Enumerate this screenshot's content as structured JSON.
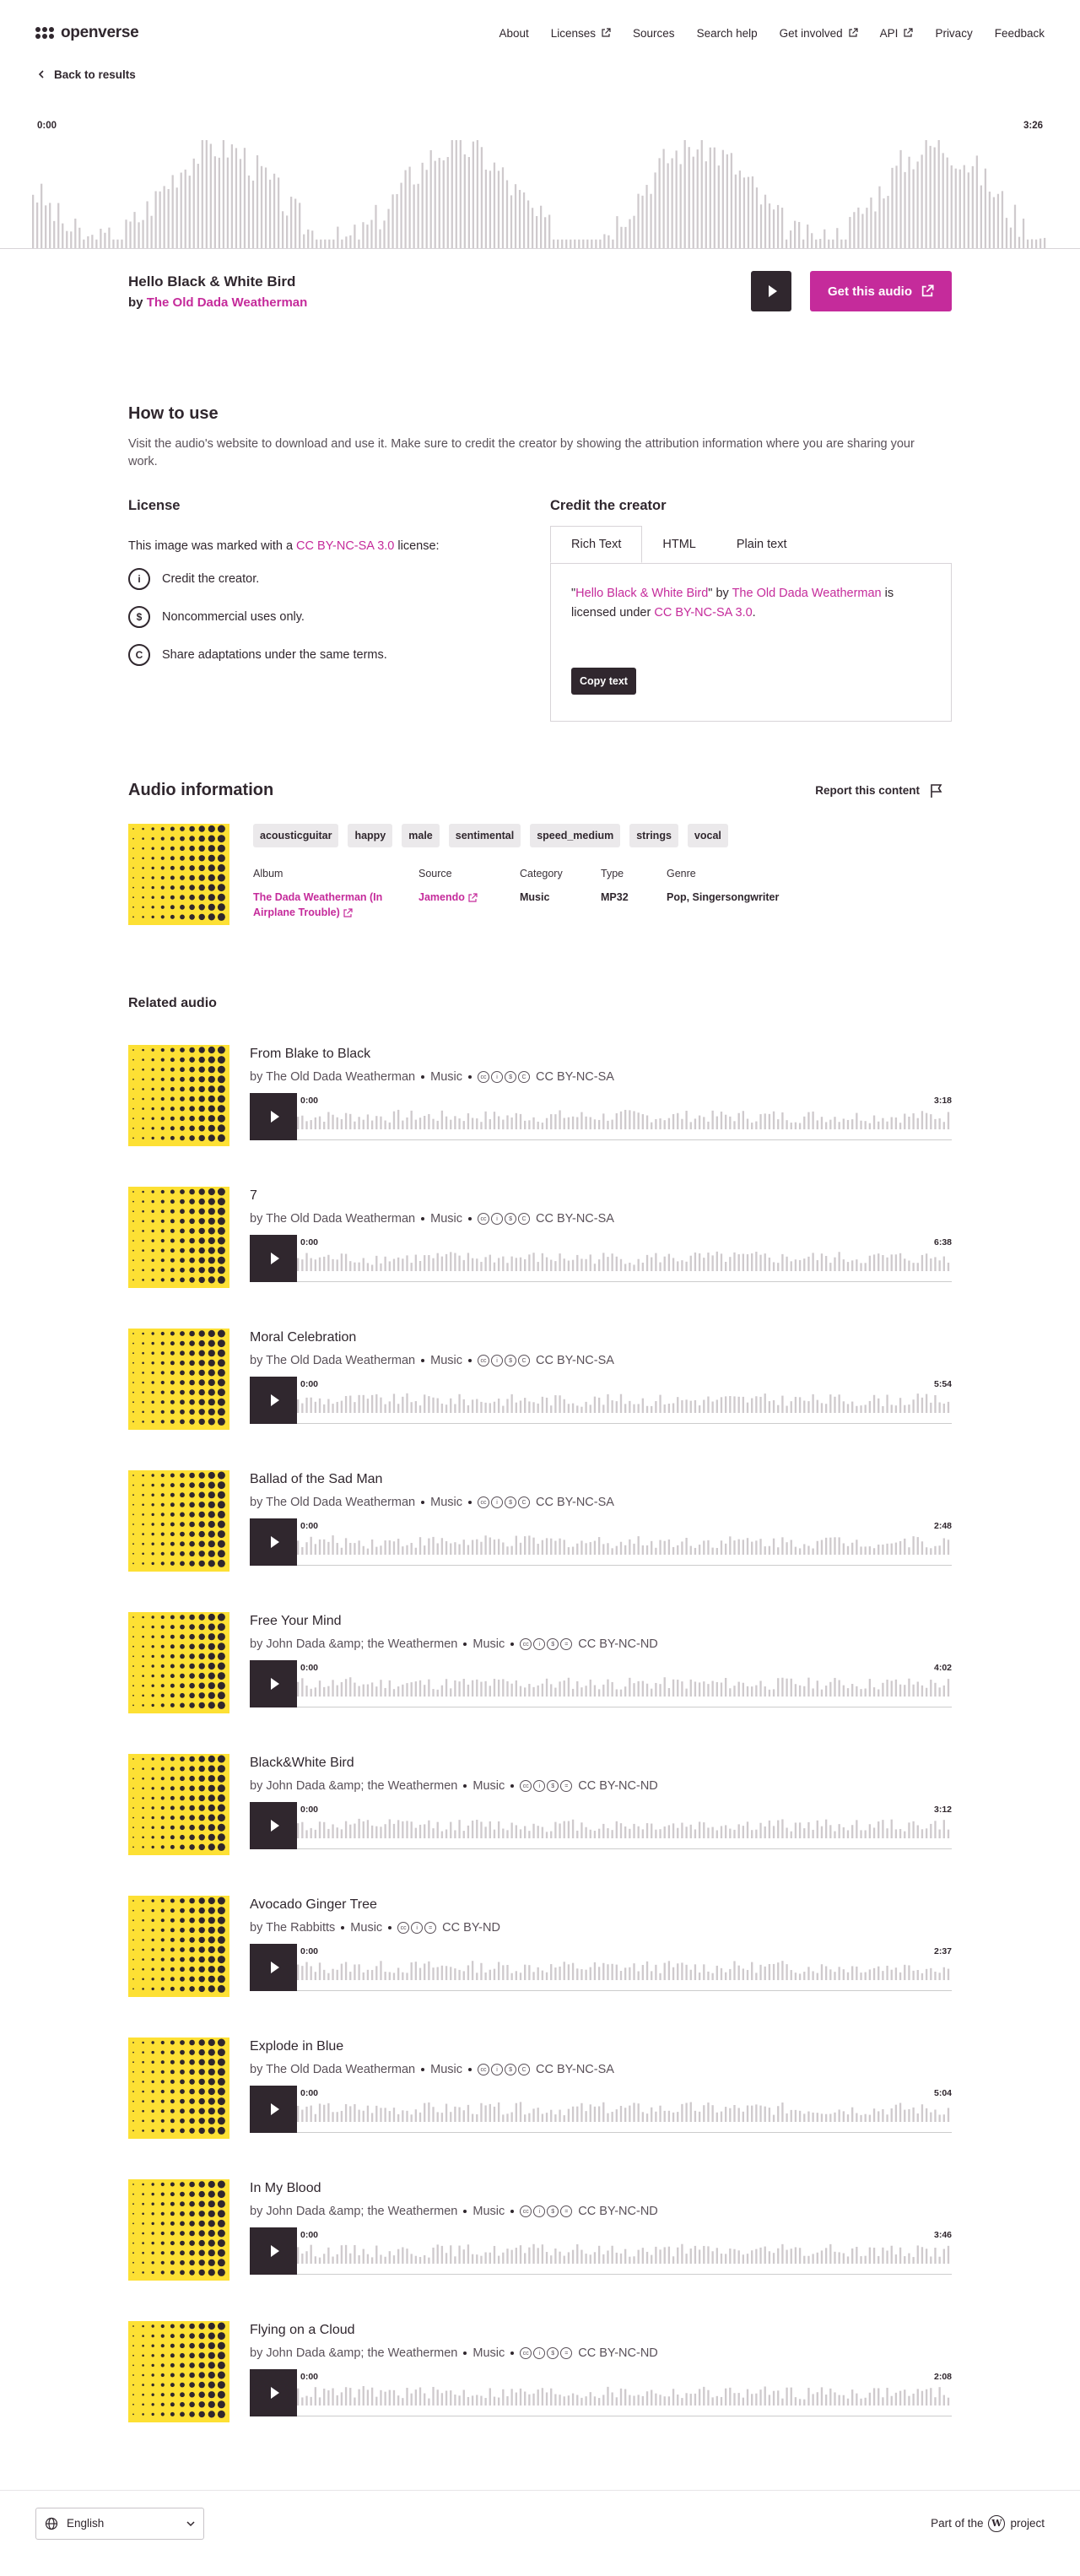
{
  "header": {
    "logo_text": "openverse",
    "nav": [
      {
        "label": "About",
        "external": false
      },
      {
        "label": "Licenses",
        "external": true
      },
      {
        "label": "Sources",
        "external": false
      },
      {
        "label": "Search help",
        "external": false
      },
      {
        "label": "Get involved",
        "external": true
      },
      {
        "label": "API",
        "external": true
      },
      {
        "label": "Privacy",
        "external": false
      },
      {
        "label": "Feedback",
        "external": false
      }
    ]
  },
  "back_label": "Back to results",
  "main_audio": {
    "start_time": "0:00",
    "end_time": "3:26",
    "title": "Hello Black & White Bird",
    "by_prefix": "by",
    "creator": "The Old Dada Weatherman",
    "get_button": "Get this audio"
  },
  "howto": {
    "title": "How to use",
    "description": "Visit the audio's website to download and use it. Make sure to credit the creator by showing the attribution information where you are sharing your work.",
    "license_title": "License",
    "license_prefix": "This image was marked with a",
    "license_name": "CC BY-NC-SA 3.0",
    "license_suffix": "license:",
    "conditions": [
      {
        "icon": "by-icon",
        "glyph": "i",
        "text": "Credit the creator."
      },
      {
        "icon": "nc-icon",
        "glyph": "$",
        "text": "Noncommercial uses only."
      },
      {
        "icon": "sa-icon",
        "glyph": "C",
        "text": "Share adaptations under the same terms."
      }
    ],
    "credit_title": "Credit the creator",
    "tabs": [
      "Rich Text",
      "HTML",
      "Plain text"
    ],
    "credit": {
      "open_quote": "\"",
      "work": "Hello Black & White Bird",
      "close_by": "\" by",
      "creator": "The Old Dada Weatherman",
      "is_licensed": "is licensed under",
      "license": "CC BY-NC-SA 3.0",
      "period": "."
    },
    "copy_button": "Copy text"
  },
  "audio_info": {
    "title": "Audio information",
    "report": "Report this content",
    "tags": [
      "acousticguitar",
      "happy",
      "male",
      "sentimental",
      "speed_medium",
      "strings",
      "vocal"
    ],
    "meta": [
      {
        "label": "Album",
        "value": "The Dada Weatherman (In Airplane Trouble)",
        "link": true,
        "external": true
      },
      {
        "label": "Source",
        "value": "Jamendo",
        "link": true,
        "external": true
      },
      {
        "label": "Category",
        "value": "Music",
        "link": false,
        "external": false
      },
      {
        "label": "Type",
        "value": "MP32",
        "link": false,
        "external": false
      },
      {
        "label": "Genre",
        "value": "Pop, Singersongwriter",
        "link": false,
        "external": false
      }
    ]
  },
  "related": {
    "title": "Related audio",
    "items": [
      {
        "title": "From Blake to Black",
        "creator": "by The Old Dada Weatherman",
        "category": "Music",
        "license": "CC BY-NC-SA",
        "icons": [
          "cc",
          "by",
          "nc",
          "sa"
        ],
        "start": "0:00",
        "duration": "3:18"
      },
      {
        "title": "7",
        "creator": "by The Old Dada Weatherman",
        "category": "Music",
        "license": "CC BY-NC-SA",
        "icons": [
          "cc",
          "by",
          "nc",
          "sa"
        ],
        "start": "0:00",
        "duration": "6:38"
      },
      {
        "title": "Moral Celebration",
        "creator": "by The Old Dada Weatherman",
        "category": "Music",
        "license": "CC BY-NC-SA",
        "icons": [
          "cc",
          "by",
          "nc",
          "sa"
        ],
        "start": "0:00",
        "duration": "5:54"
      },
      {
        "title": "Ballad of the Sad Man",
        "creator": "by The Old Dada Weatherman",
        "category": "Music",
        "license": "CC BY-NC-SA",
        "icons": [
          "cc",
          "by",
          "nc",
          "sa"
        ],
        "start": "0:00",
        "duration": "2:48"
      },
      {
        "title": "Free Your Mind",
        "creator": "by John Dada &amp; the Weathermen",
        "category": "Music",
        "license": "CC BY-NC-ND",
        "icons": [
          "cc",
          "by",
          "nc",
          "nd"
        ],
        "start": "0:00",
        "duration": "4:02"
      },
      {
        "title": "Black&White Bird",
        "creator": "by John Dada &amp; the Weathermen",
        "category": "Music",
        "license": "CC BY-NC-ND",
        "icons": [
          "cc",
          "by",
          "nc",
          "nd"
        ],
        "start": "0:00",
        "duration": "3:12"
      },
      {
        "title": "Avocado Ginger Tree",
        "creator": "by The Rabbitts",
        "category": "Music",
        "license": "CC BY-ND",
        "icons": [
          "cc",
          "by",
          "nd"
        ],
        "start": "0:00",
        "duration": "2:37"
      },
      {
        "title": "Explode in Blue",
        "creator": "by The Old Dada Weatherman",
        "category": "Music",
        "license": "CC BY-NC-SA",
        "icons": [
          "cc",
          "by",
          "nc",
          "sa"
        ],
        "start": "0:00",
        "duration": "5:04"
      },
      {
        "title": "In My Blood",
        "creator": "by John Dada &amp; the Weathermen",
        "category": "Music",
        "license": "CC BY-NC-ND",
        "icons": [
          "cc",
          "by",
          "nc",
          "nd"
        ],
        "start": "0:00",
        "duration": "3:46"
      },
      {
        "title": "Flying on a Cloud",
        "creator": "by John Dada &amp; the Weathermen",
        "category": "Music",
        "license": "CC BY-NC-ND",
        "icons": [
          "cc",
          "by",
          "nc",
          "nd"
        ],
        "start": "0:00",
        "duration": "2:08"
      }
    ]
  },
  "footer": {
    "language": "English",
    "part_prefix": "Part of the",
    "part_suffix": "project"
  },
  "colors": {
    "accent": "#c52b9b",
    "dark": "#30272e",
    "thumb_yellow": "#fde034"
  }
}
